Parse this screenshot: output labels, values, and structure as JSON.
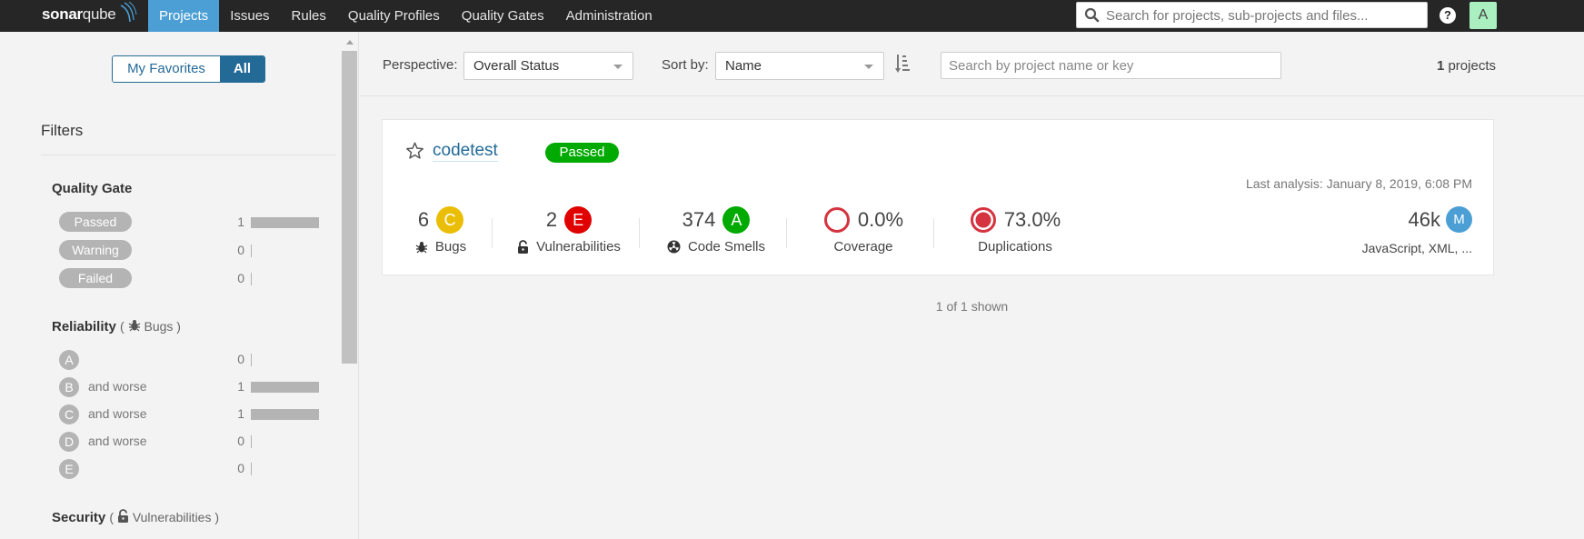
{
  "topbar": {
    "logo_bold": "sonar",
    "logo_light": "qube",
    "nav": [
      {
        "label": "Projects",
        "active": true
      },
      {
        "label": "Issues",
        "active": false
      },
      {
        "label": "Rules",
        "active": false
      },
      {
        "label": "Quality Profiles",
        "active": false
      },
      {
        "label": "Quality Gates",
        "active": false
      },
      {
        "label": "Administration",
        "active": false
      }
    ],
    "search_placeholder": "Search for projects, sub-projects and files...",
    "help_icon": "?",
    "avatar_letter": "A",
    "avatar_color": "#a9efc0"
  },
  "sidebar": {
    "favorites_label": "My Favorites",
    "all_label": "All",
    "filters_title": "Filters",
    "quality_gate": {
      "title": "Quality Gate",
      "rows": [
        {
          "label": "Passed",
          "count": "1",
          "fraction": 1
        },
        {
          "label": "Warning",
          "count": "0",
          "fraction": 0
        },
        {
          "label": "Failed",
          "count": "0",
          "fraction": 0
        }
      ]
    },
    "reliability": {
      "title": "Reliability",
      "open_paren": "(",
      "sub_label": "Bugs )",
      "rows": [
        {
          "rating": "A",
          "suffix": "",
          "count": "0",
          "fraction": 0
        },
        {
          "rating": "B",
          "suffix": "and worse",
          "count": "1",
          "fraction": 1
        },
        {
          "rating": "C",
          "suffix": "and worse",
          "count": "1",
          "fraction": 1
        },
        {
          "rating": "D",
          "suffix": "and worse",
          "count": "0",
          "fraction": 0
        },
        {
          "rating": "E",
          "suffix": "",
          "count": "0",
          "fraction": 0
        }
      ]
    },
    "security": {
      "title": "Security",
      "open_paren": "(",
      "sub_label": "Vulnerabilities )"
    }
  },
  "header": {
    "perspective_label": "Perspective:",
    "perspective_value": "Overall Status",
    "sort_label": "Sort by:",
    "sort_value": "Name",
    "search_placeholder": "Search by project name or key",
    "project_count": "1",
    "project_count_suffix": " projects"
  },
  "project": {
    "name": "codetest",
    "quality_gate": "Passed",
    "quality_gate_color": "#00aa00",
    "last_analysis": "Last analysis: January 8, 2019, 6:08 PM",
    "bugs": {
      "value": "6",
      "rating": "C",
      "rating_color": "#eabe06",
      "label": "Bugs"
    },
    "vulnerabilities": {
      "value": "2",
      "rating": "E",
      "rating_color": "#e00000",
      "label": "Vulnerabilities"
    },
    "code_smells": {
      "value": "374",
      "rating": "A",
      "rating_color": "#00aa00",
      "label": "Code Smells"
    },
    "coverage": {
      "value": "0.0%",
      "label": "Coverage"
    },
    "duplications": {
      "value": "73.0%",
      "label": "Duplications"
    },
    "size": {
      "value": "46k",
      "rating": "M",
      "rating_color": "#4b9fd5"
    },
    "languages": "JavaScript, XML, ..."
  },
  "footer": {
    "shown": "1 of 1 shown"
  }
}
